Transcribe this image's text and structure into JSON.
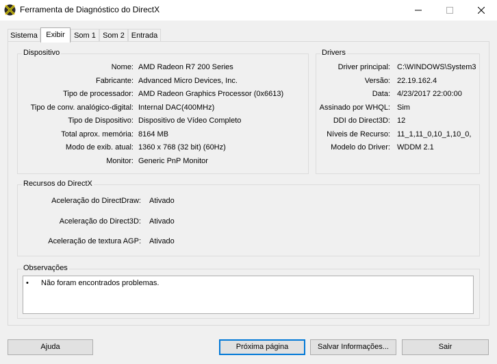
{
  "window": {
    "title": "Ferramenta de Diagnóstico do DirectX",
    "icon": "directx-icon",
    "controls": [
      "minimize-icon",
      "maximize-icon",
      "close-icon"
    ]
  },
  "tabs": [
    {
      "label": "Sistema",
      "active": false
    },
    {
      "label": "Exibir",
      "active": true
    },
    {
      "label": "Som 1",
      "active": false
    },
    {
      "label": "Som 2",
      "active": false
    },
    {
      "label": "Entrada",
      "active": false
    }
  ],
  "device": {
    "title": "Dispositivo",
    "fields": [
      {
        "label": "Nome:",
        "value": "AMD Radeon R7 200 Series"
      },
      {
        "label": "Fabricante:",
        "value": "Advanced Micro Devices, Inc."
      },
      {
        "label": "Tipo de processador:",
        "value": "AMD Radeon Graphics Processor (0x6613)"
      },
      {
        "label": "Tipo de conv. analógico-digital:",
        "value": "Internal DAC(400MHz)"
      },
      {
        "label": "Tipo de Dispositivo:",
        "value": "Dispositivo de Vídeo Completo"
      },
      {
        "label": "Total aprox. memória:",
        "value": "8164 MB"
      },
      {
        "label": "Modo de exib. atual:",
        "value": "1360 x 768 (32 bit) (60Hz)"
      },
      {
        "label": "Monitor:",
        "value": "Generic PnP Monitor"
      }
    ]
  },
  "drivers": {
    "title": "Drivers",
    "fields": [
      {
        "label": "Driver principal:",
        "value": "C:\\WINDOWS\\System3"
      },
      {
        "label": "Versão:",
        "value": "22.19.162.4"
      },
      {
        "label": "Data:",
        "value": "4/23/2017 22:00:00"
      },
      {
        "label": "Assinado por WHQL:",
        "value": "Sim"
      },
      {
        "label": "DDI do Direct3D:",
        "value": "12"
      },
      {
        "label": "Níveis de Recurso:",
        "value": "11_1,11_0,10_1,10_0,"
      },
      {
        "label": "Modelo do Driver:",
        "value": "WDDM 2.1"
      }
    ]
  },
  "features": {
    "title": "Recursos do DirectX",
    "fields": [
      {
        "label": "Aceleração do DirectDraw:",
        "value": "Ativado"
      },
      {
        "label": "Aceleração do Direct3D:",
        "value": "Ativado"
      },
      {
        "label": "Aceleração de textura AGP:",
        "value": "Ativado"
      }
    ]
  },
  "notes": {
    "title": "Observações",
    "bullet": "•",
    "text": "Não foram encontrados problemas."
  },
  "buttons": {
    "help": "Ajuda",
    "next": "Próxima página",
    "save": "Salvar Informações...",
    "exit": "Sair"
  }
}
